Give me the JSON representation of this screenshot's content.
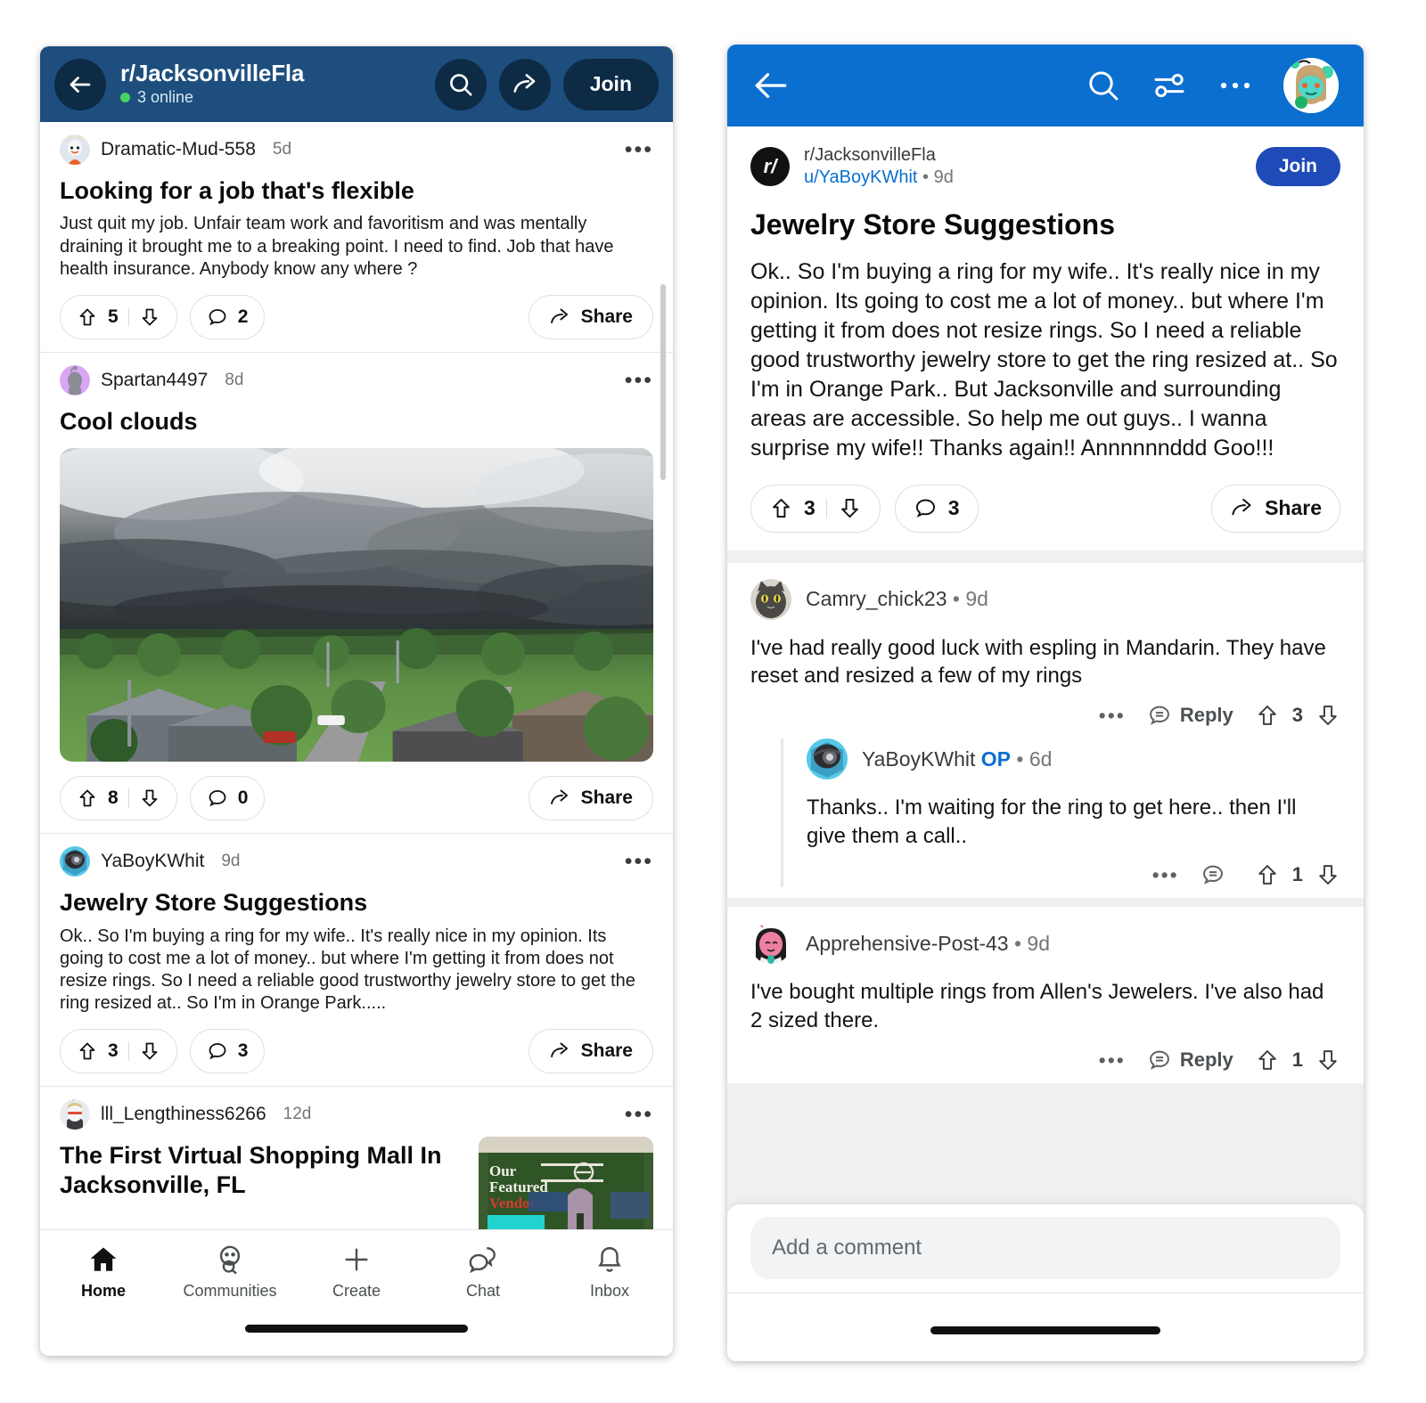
{
  "left_phone": {
    "header": {
      "back_icon": "back-arrow-icon",
      "subreddit": "r/JacksonvilleFla",
      "online": "3 online",
      "search_icon": "search-icon",
      "share_icon": "share-icon",
      "join_label": "Join"
    },
    "posts": [
      {
        "author": "Dramatic-Mud-558",
        "time": "5d",
        "title": "Looking for a job that's flexible",
        "body": "Just quit my job. Unfair team work and favoritism and was mentally draining it brought me to a breaking point. I need to find. Job that have health insurance. Anybody know any where ?",
        "upvotes": "5",
        "comments": "2",
        "share_label": "Share"
      },
      {
        "author": "Spartan4497",
        "time": "8d",
        "title": "Cool clouds",
        "body": "",
        "upvotes": "8",
        "comments": "0",
        "share_label": "Share"
      },
      {
        "author": "YaBoyKWhit",
        "time": "9d",
        "title": "Jewelry Store Suggestions",
        "body": "Ok.. So I'm buying a ring for my wife.. It's really nice in my opinion. Its going to cost me a lot of money.. but where I'm getting it from does not resize rings. So I need a reliable good trustworthy jewelry store to get the ring resized at.. So I'm in Orange Park.....",
        "upvotes": "3",
        "comments": "3",
        "share_label": "Share"
      },
      {
        "author": "lll_Lengthiness6266",
        "time": "12d",
        "title": "The First Virtual Shopping Mall In Jacksonville, FL",
        "body": "",
        "upvotes": "",
        "comments": "",
        "share_label": ""
      }
    ],
    "bottom_nav": [
      {
        "label": "Home",
        "icon": "home-icon"
      },
      {
        "label": "Communities",
        "icon": "communities-icon"
      },
      {
        "label": "Create",
        "icon": "plus-icon"
      },
      {
        "label": "Chat",
        "icon": "chat-icon"
      },
      {
        "label": "Inbox",
        "icon": "bell-icon"
      }
    ]
  },
  "right_phone": {
    "header": {
      "back_icon": "back-arrow-icon",
      "search_icon": "search-icon",
      "sort_icon": "sort-filter-icon",
      "more_icon": "more-options-icon",
      "avatar": "user-avatar"
    },
    "post": {
      "subreddit": "r/JacksonvilleFla",
      "user": "u/YaBoyKWhit",
      "time": "9d",
      "separator": "•",
      "join_label": "Join",
      "title": "Jewelry Store Suggestions",
      "body": "Ok.. So I'm buying a ring for my wife.. It's really nice in my opinion. Its going to cost me a lot of money.. but where I'm getting it from does not resize rings. So I need a reliable good trustworthy jewelry store to get the ring resized at.. So I'm in Orange Park.. But Jacksonville and surrounding areas are accessible. So help me out guys.. I wanna surprise my wife!! Thanks again!! Annnnnnddd Goo!!!",
      "upvotes": "3",
      "comments": "3",
      "share_label": "Share"
    },
    "comments": [
      {
        "author": "Camry_chick23",
        "time": "9d",
        "separator": "•",
        "op_tag": "",
        "body": "I've had really good luck with espling in Mandarin. They have reset and resized a few of my rings",
        "reply_label": "Reply",
        "score": "3",
        "nested": false
      },
      {
        "author": "YaBoyKWhit",
        "time": "6d",
        "separator": "•",
        "op_tag": "OP",
        "body": "Thanks.. I'm waiting for the ring to get here.. then I'll give them a call..",
        "reply_label": "",
        "score": "1",
        "nested": true
      },
      {
        "author": "Apprehensive-Post-43",
        "time": "9d",
        "separator": "•",
        "op_tag": "",
        "body": "I've bought multiple rings from Allen's Jewelers. I've also had 2 sized there.",
        "reply_label": "Reply",
        "score": "1",
        "nested": false
      }
    ],
    "comment_box": {
      "placeholder": "Add a comment"
    }
  },
  "colors": {
    "left_header_blue": "#1d4e7e",
    "right_header_blue": "#0b6fd0",
    "join_blue": "#1e4bb8",
    "link_blue": "#0b6fd0",
    "online_green": "#46d160"
  }
}
